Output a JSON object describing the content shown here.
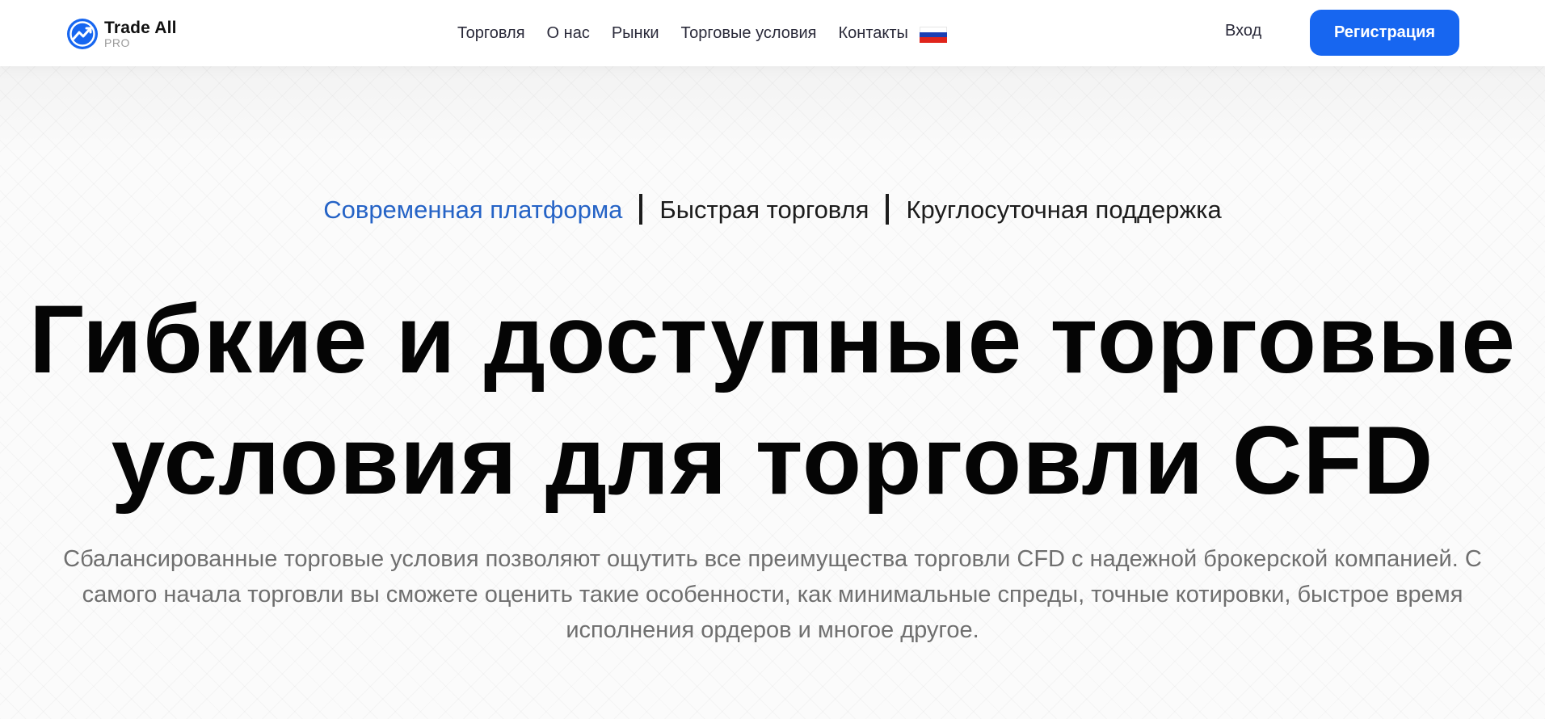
{
  "header": {
    "logo": {
      "name": "Trade All",
      "sub": "PRO",
      "brand_color": "#1766f0"
    },
    "nav": [
      {
        "label": "Торговля"
      },
      {
        "label": "О нас"
      },
      {
        "label": "Рынки"
      },
      {
        "label": "Торговые условия"
      },
      {
        "label": "Контакты"
      }
    ],
    "language_flag": "russia-flag-icon",
    "login_label": "Вход",
    "register_label": "Регистрация"
  },
  "hero": {
    "taglines": [
      {
        "label": "Современная платформа",
        "active": true
      },
      {
        "label": "Быстрая торговля",
        "active": false
      },
      {
        "label": "Круглосуточная поддержка",
        "active": false
      }
    ],
    "headline_line1": "Гибкие и доступные торговые",
    "headline_line2": "условия для торговли CFD",
    "description": "Сбалансированные торговые условия позволяют ощутить все преимущества торговли CFD с надежной брокерской компанией. С самого начала торговли вы сможете оценить такие особенности, как минимальные спреды, точные котировки, быстрое время исполнения ордеров и многое другое.",
    "accent_color": "#2563c6"
  }
}
